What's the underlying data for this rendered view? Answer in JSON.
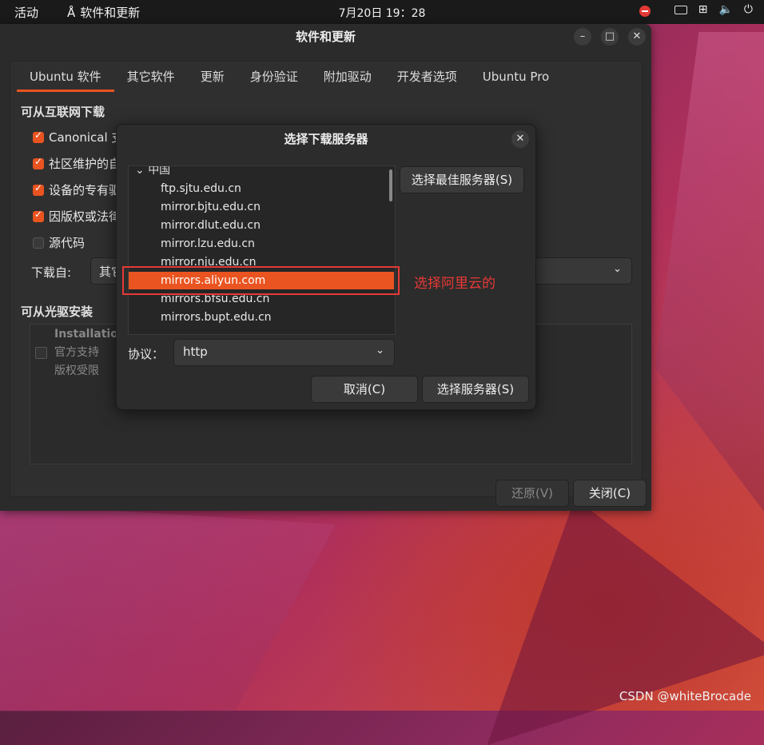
{
  "topbar": {
    "activities": "活动",
    "app_name": "软件和更新",
    "clock": "7月20日  19：28"
  },
  "window": {
    "title": "软件和更新",
    "tabs": [
      "Ubuntu 软件",
      "其它软件",
      "更新",
      "身份验证",
      "附加驱动",
      "开发者选项",
      "Ubuntu Pro"
    ],
    "internet_section": "可从互联网下载",
    "checkboxes": [
      {
        "label": "Canonical 支",
        "checked": true
      },
      {
        "label": "社区维护的自",
        "checked": true
      },
      {
        "label": "设备的专有驱",
        "checked": true
      },
      {
        "label": "因版权或法律",
        "checked": true
      },
      {
        "label": "源代码",
        "checked": false
      }
    ],
    "download_from_label": "下载自:",
    "download_from_value": "其它",
    "cdrom_section": "可从光驱安装",
    "cdrom_title": "Installation",
    "cdrom_lines": [
      "官方支持",
      "版权受限"
    ],
    "revert_button": "还原(V)",
    "close_button": "关闭(C)"
  },
  "dialog": {
    "title": "选择下载服务器",
    "group": "中国",
    "servers": [
      "ftp.sjtu.edu.cn",
      "mirror.bjtu.edu.cn",
      "mirror.dlut.edu.cn",
      "mirror.lzu.edu.cn",
      "mirror.nju.edu.cn",
      "mirrors.aliyun.com",
      "mirrors.bfsu.edu.cn",
      "mirrors.bupt.edu.cn"
    ],
    "selected_index": 5,
    "best_server_button": "选择最佳服务器(S)",
    "protocol_label": "协议：",
    "protocol_value": "http",
    "cancel_button": "取消(C)",
    "choose_button": "选择服务器(S)"
  },
  "annotation": "选择阿里云的",
  "watermark": "CSDN @whiteBrocade",
  "colors": {
    "accent": "#e95420",
    "annotation": "#e53935"
  }
}
